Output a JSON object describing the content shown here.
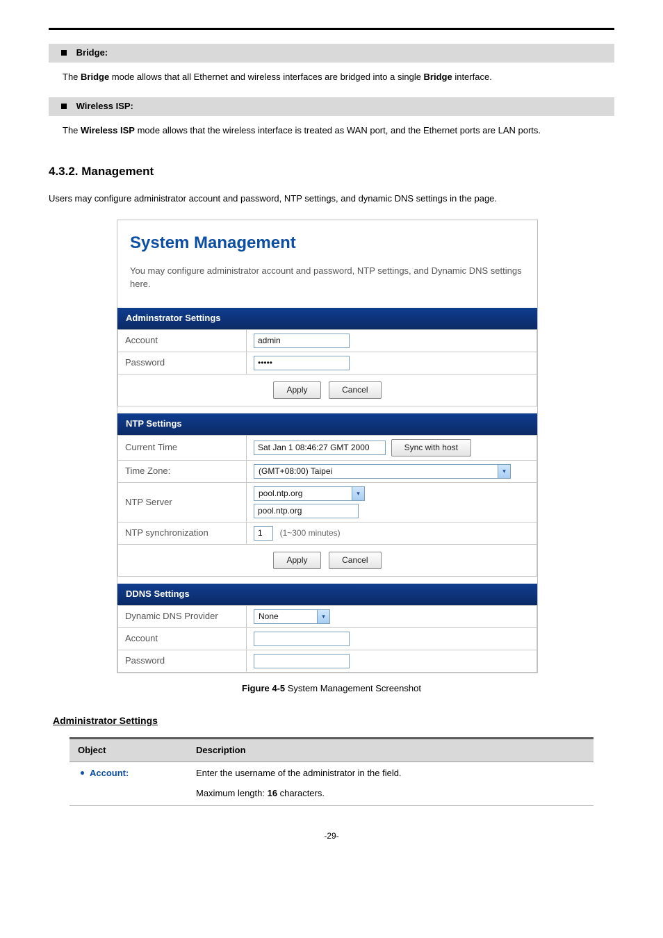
{
  "sections": {
    "bridge": {
      "label": "Bridge:",
      "text_pre": "The ",
      "text_bold1": "Bridge",
      "text_mid": " mode allows that all Ethernet and wireless interfaces are bridged into a single ",
      "text_bold2": "Bridge",
      "text_post": " interface."
    },
    "wisp": {
      "label": "Wireless ISP:",
      "text_pre": "The ",
      "text_bold1": "Wireless ISP",
      "text_mid": " mode allows that the wireless interface is treated as WAN port, and the Ethernet ports are LAN ports."
    }
  },
  "heading": "4.3.2.  Management",
  "intro": "Users may configure administrator account and password, NTP settings, and dynamic DNS settings in the page.",
  "screenshot": {
    "title": "System Management",
    "desc": "You may configure administrator account and password, NTP settings, and Dynamic DNS settings here.",
    "admin": {
      "header": "Adminstrator Settings",
      "account_label": "Account",
      "account_value": "admin",
      "password_label": "Password",
      "password_value": "•••••",
      "apply": "Apply",
      "cancel": "Cancel"
    },
    "ntp": {
      "header": "NTP Settings",
      "current_label": "Current Time",
      "current_value": "Sat Jan  1 08:46:27 GMT 2000",
      "sync_btn": "Sync with host",
      "tz_label": "Time Zone:",
      "tz_value": "(GMT+08:00) Taipei",
      "server_label": "NTP Server",
      "server_select": "pool.ntp.org",
      "server_text": "pool.ntp.org",
      "sync_label": "NTP synchronization",
      "sync_value": "1",
      "sync_hint": "(1~300 minutes)",
      "apply": "Apply",
      "cancel": "Cancel"
    },
    "ddns": {
      "header": "DDNS Settings",
      "provider_label": "Dynamic DNS Provider",
      "provider_value": "None",
      "account_label": "Account",
      "password_label": "Password"
    }
  },
  "caption_pre": "Figure 4-5",
  "caption_post": " System Management Screenshot",
  "subhead": "Administrator Settings",
  "table": {
    "h1": "Object",
    "h2": "Description",
    "row1_obj": "Account:",
    "row1_desc1": "Enter the username of the administrator in the field.",
    "row1_desc2_pre": "Maximum length: ",
    "row1_desc2_bold": "16",
    "row1_desc2_post": " characters."
  },
  "pagenum": "-29-"
}
